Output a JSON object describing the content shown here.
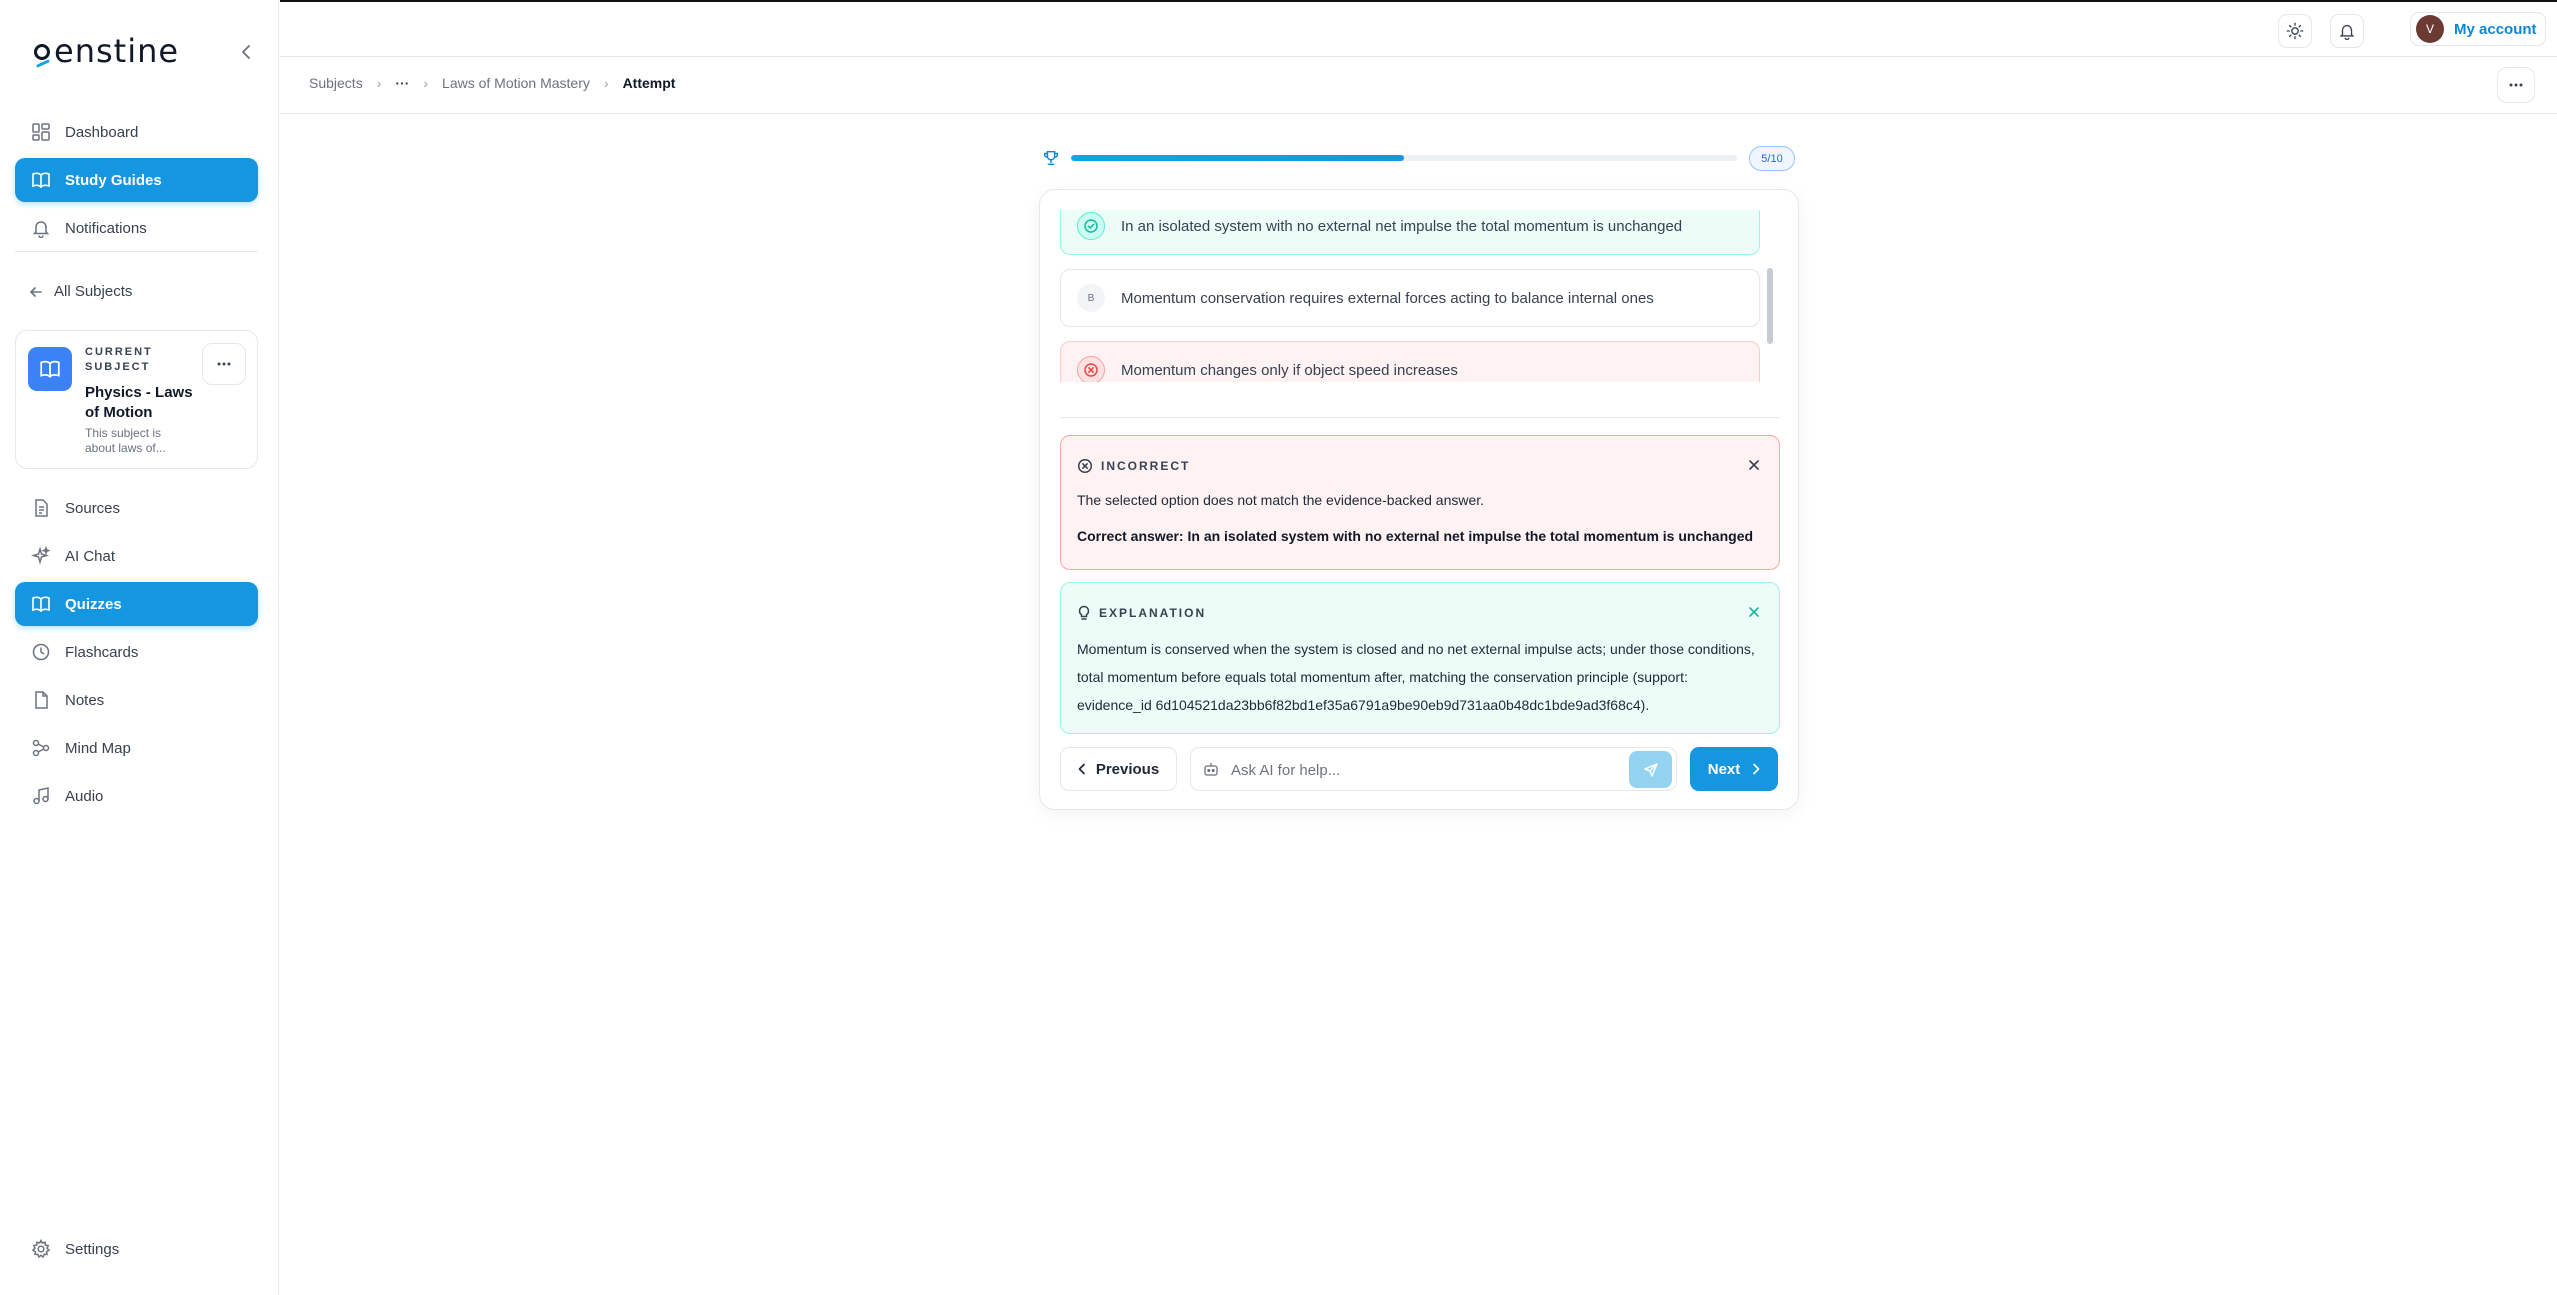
{
  "brand": {
    "name": "enstine"
  },
  "sidebar": {
    "top_items": [
      {
        "label": "Dashboard",
        "icon": "grid-icon"
      },
      {
        "label": "Study Guides",
        "icon": "book-open-icon",
        "active": true
      },
      {
        "label": "Notifications",
        "icon": "bell-icon"
      }
    ],
    "back_label": "All Subjects",
    "subject_card": {
      "kicker": "CURRENT SUBJECT",
      "title": "Physics - Laws of Motion",
      "description": "This subject is about laws of..."
    },
    "subject_items": [
      {
        "label": "Sources",
        "icon": "document-icon"
      },
      {
        "label": "AI Chat",
        "icon": "sparkles-icon"
      },
      {
        "label": "Quizzes",
        "icon": "book-open-icon",
        "active": true
      },
      {
        "label": "Flashcards",
        "icon": "clock-icon"
      },
      {
        "label": "Notes",
        "icon": "note-icon"
      },
      {
        "label": "Mind Map",
        "icon": "mind-map-icon"
      },
      {
        "label": "Audio",
        "icon": "music-note-icon"
      }
    ],
    "settings_label": "Settings"
  },
  "topbar": {
    "account_initial": "V",
    "account_label": "My account"
  },
  "breadcrumb": {
    "root": "Subjects",
    "ellipsis": "···",
    "parent": "Laws of Motion Mastery",
    "current": "Attempt"
  },
  "progress": {
    "current": 5,
    "total": 10,
    "label": "5/10",
    "fraction": 0.5
  },
  "quiz": {
    "options": [
      {
        "marker": "",
        "text": "In an isolated system with no external net impulse the total momentum is unchanged",
        "state": "correct"
      },
      {
        "marker": "B",
        "text": "Momentum conservation requires external forces acting to balance internal ones",
        "state": "neutral"
      },
      {
        "marker": "",
        "text": "Momentum changes only if object speed increases",
        "state": "wrong"
      }
    ],
    "incorrect": {
      "heading": "INCORRECT",
      "message": "The selected option does not match the evidence-backed answer.",
      "correct_answer": "Correct answer: In an isolated system with no external net impulse the total momentum is unchanged"
    },
    "explanation": {
      "heading": "EXPLANATION",
      "text": "Momentum is conserved when the system is closed and no net external impulse acts; under those conditions, total momentum before equals total momentum after, matching the conservation principle (support: evidence_id 6d104521da23bb6f82bd1ef35a6791a9be90eb9d731aa0b48dc1bde9ad3f68c4)."
    },
    "prev_label": "Previous",
    "next_label": "Next",
    "ask_placeholder": "Ask AI for help..."
  },
  "colors": {
    "accent": "#1596e0",
    "correct_bg": "#ecfdf8",
    "wrong_bg": "#fef2f2"
  }
}
